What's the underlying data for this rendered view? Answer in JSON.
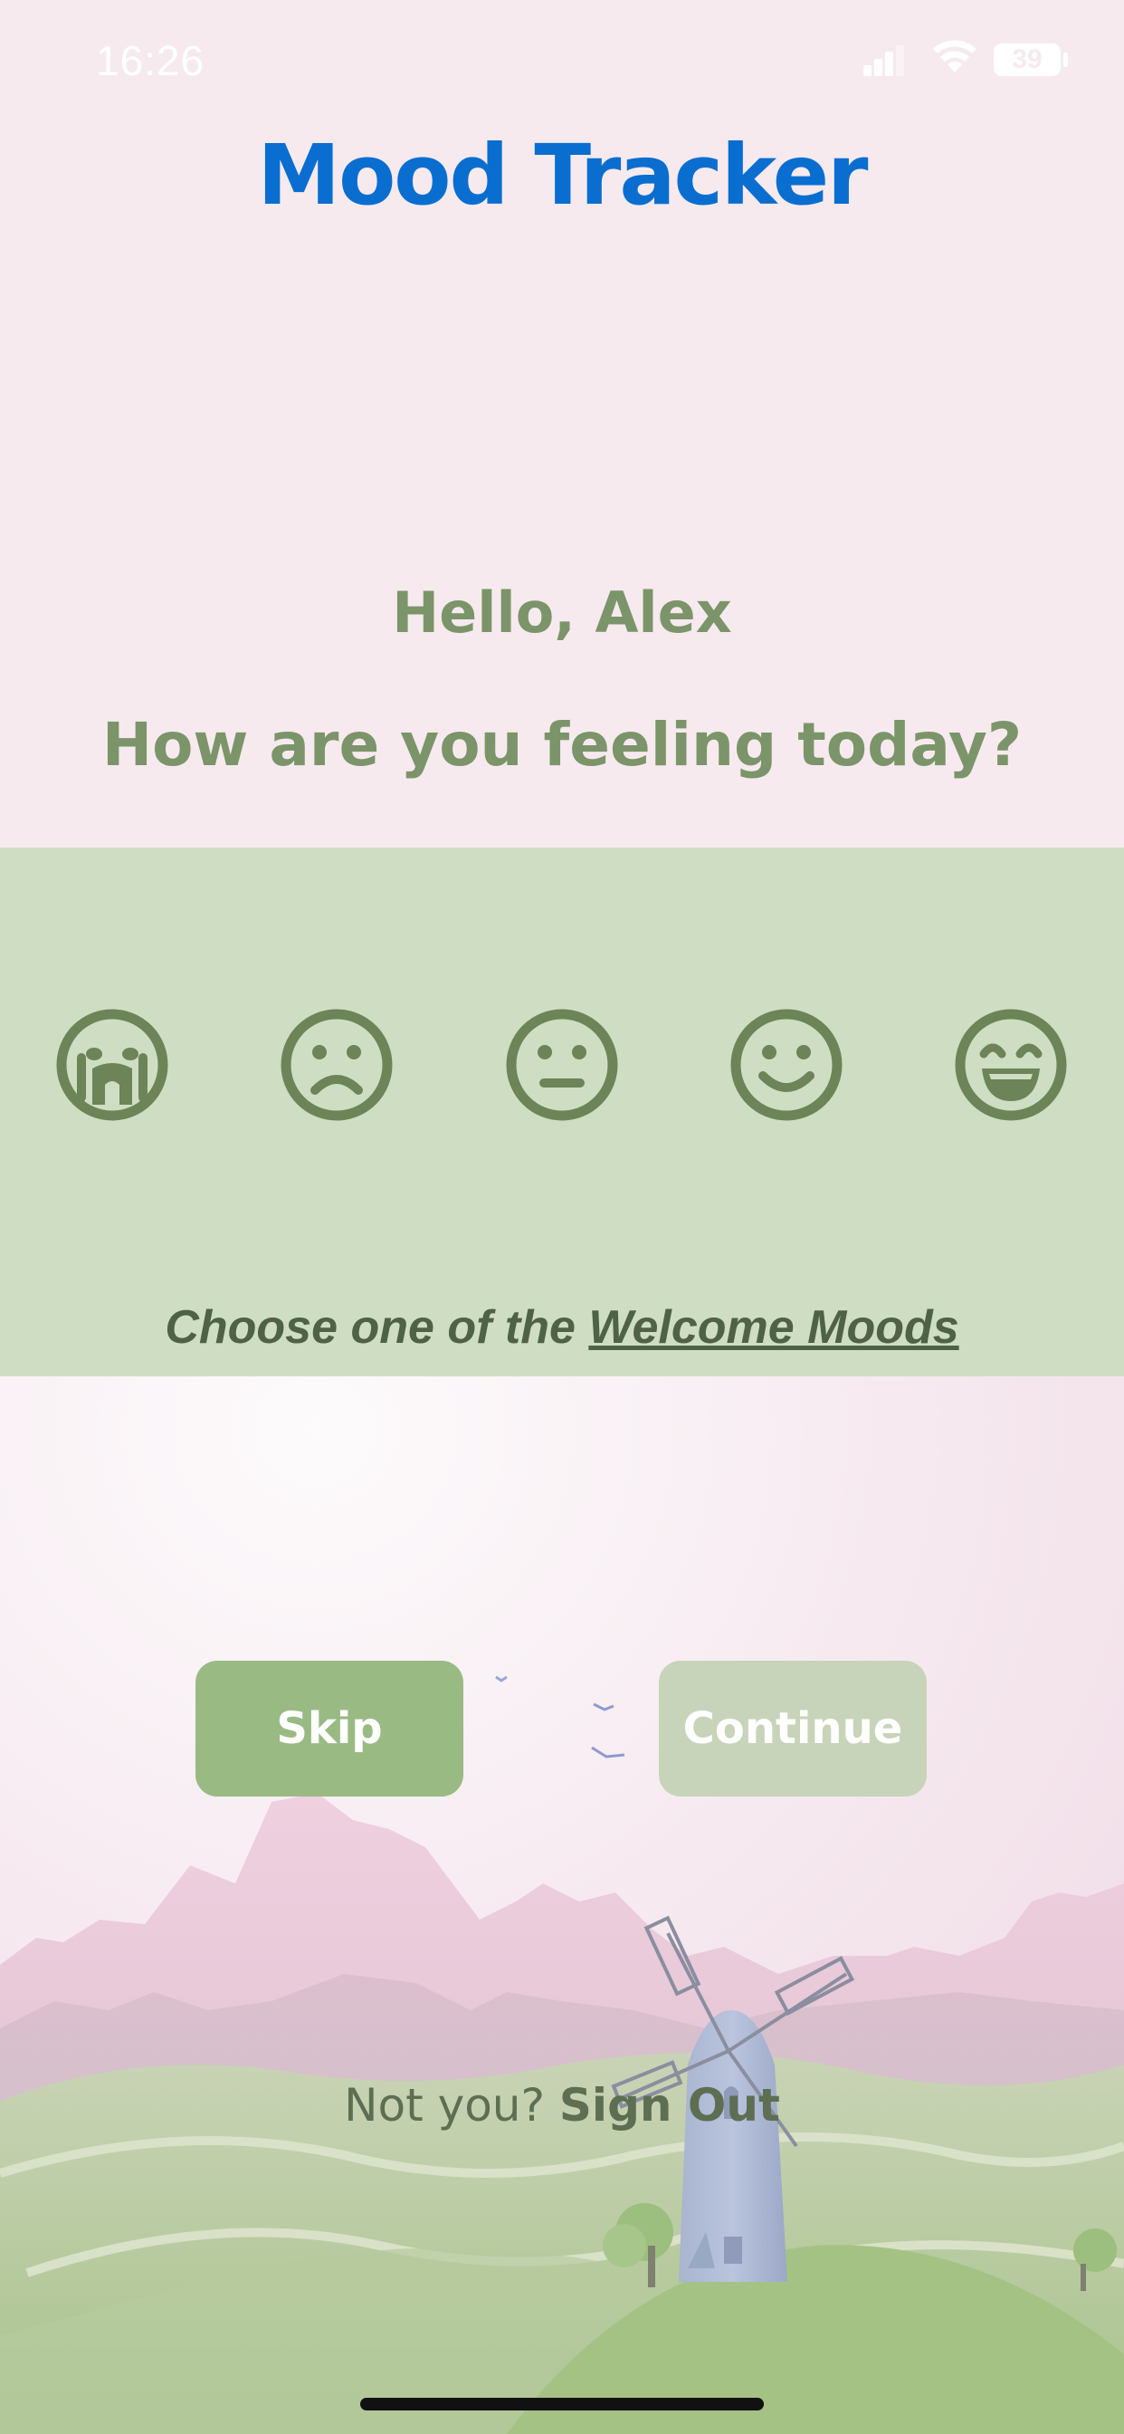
{
  "status_bar": {
    "time": "16:26",
    "battery": "39"
  },
  "header": {
    "title": "Mood Tracker"
  },
  "greeting": {
    "hello": "Hello, Alex",
    "question": "How are you feeling today?"
  },
  "moods": [
    {
      "icon": "crying-face-icon"
    },
    {
      "icon": "frowning-face-icon"
    },
    {
      "icon": "neutral-face-icon"
    },
    {
      "icon": "smiling-face-icon"
    },
    {
      "icon": "grinning-face-icon"
    }
  ],
  "hint": {
    "prefix": "Choose one of the ",
    "link": "Welcome Moods"
  },
  "actions": {
    "skip_label": "Skip",
    "continue_label": "Continue"
  },
  "signout": {
    "prefix": "Not you? ",
    "link": "Sign Out"
  },
  "colors": {
    "title": "#0a6ed0",
    "text_green": "#7c9469",
    "mood_band": "#cfdec2",
    "skip_button": "#9aba84",
    "continue_button_disabled": "#c7d4b9",
    "background": "#f6eaef"
  }
}
